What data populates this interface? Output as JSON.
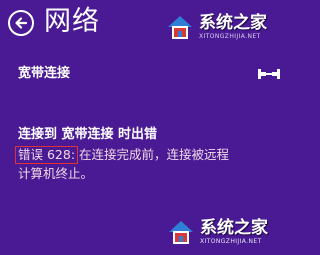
{
  "header": {
    "back_icon": "back-arrow-icon",
    "title": "网络"
  },
  "watermark": {
    "site_name": "系统之家",
    "url_text": "XITONGZHIJIA.NET",
    "logo_icon": "house-logo-icon"
  },
  "connection": {
    "name": "宽带连接",
    "icon": "ethernet-plug-icon"
  },
  "error": {
    "title": "连接到 宽带连接 时出错",
    "code": "错误 628:",
    "message_part1": "在连接完成前，连接被远程",
    "message_part2": "计算机终止。",
    "highlight_color": "#e0303a"
  },
  "colors": {
    "background": "#4a1a94",
    "text": "#ffffff"
  }
}
